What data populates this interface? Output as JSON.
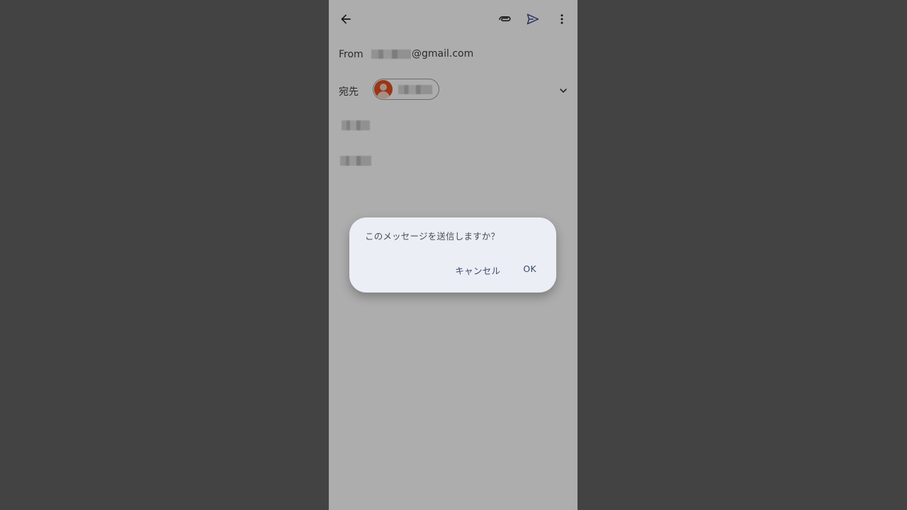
{
  "compose": {
    "from_label": "From",
    "from_email_suffix": "@gmail.com",
    "to_label": "宛先"
  },
  "dialog": {
    "message": "このメッセージを送信しますか？",
    "cancel_label": "キャンセル",
    "ok_label": "OK"
  },
  "colors": {
    "page_background": "#434343",
    "avatar": "#e2501f",
    "dialog_surface": "#eceef5",
    "action_text": "#3b4a6b",
    "send_icon": "#3b4a8f"
  },
  "icons": {
    "back": "arrow-back-icon",
    "attach": "paperclip-icon",
    "send": "send-icon",
    "more": "more-vert-icon",
    "expand": "chevron-down-icon",
    "avatar": "person-icon"
  }
}
